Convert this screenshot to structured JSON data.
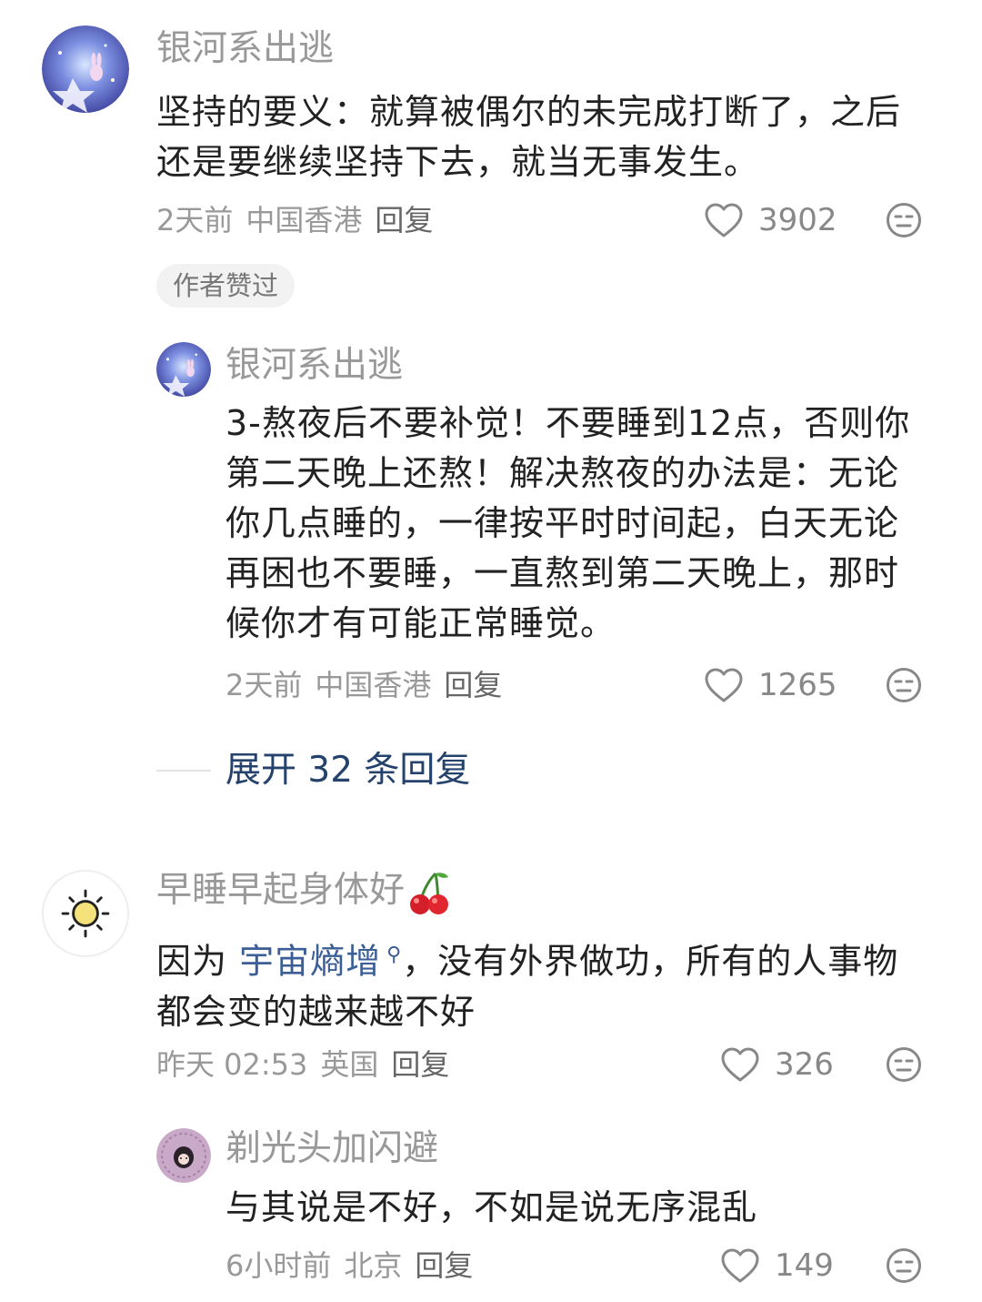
{
  "comments": [
    {
      "username": "银河系出逃",
      "text": "坚持的要义：就算被偶尔的未完成打断了，之后还是要继续坚持下去，就当无事发生。",
      "time": "2天前",
      "location": "中国香港",
      "reply_label": "回复",
      "likes": "3902",
      "badge": "作者赞过",
      "replies": [
        {
          "username": "银河系出逃",
          "text": "3-熬夜后不要补觉！不要睡到12点，否则你第二天晚上还熬！解决熬夜的办法是：无论你几点睡的，一律按平时时间起，白天无论再困也不要睡，一直熬到第二天晚上，那时候你才有可能正常睡觉。",
          "time": "2天前",
          "location": "中国香港",
          "reply_label": "回复",
          "likes": "1265"
        }
      ],
      "expand_label": "展开 32 条回复"
    },
    {
      "username": "早睡早起身体好",
      "text_before": "因为 ",
      "link_text": "宇宙熵增",
      "text_after": "，没有外界做功，所有的人事物都会变的越来越不好",
      "time": "昨天 02:53",
      "location": "英国",
      "reply_label": "回复",
      "likes": "326",
      "replies": [
        {
          "username": "剃光头加闪避",
          "text": "与其说是不好，不如是说无序混乱",
          "time": "6小时前",
          "location": "北京",
          "reply_label": "回复",
          "likes": "149"
        }
      ]
    }
  ],
  "colors": {
    "link": "#3a5e95",
    "expand": "#24426b",
    "meta": "#999999",
    "badge_bg": "#f2f2f2"
  },
  "icons": {
    "like": "heart-outline-icon",
    "dislike": "meh-face-icon",
    "search": "search-icon",
    "cherry": "cherry-emoji"
  }
}
